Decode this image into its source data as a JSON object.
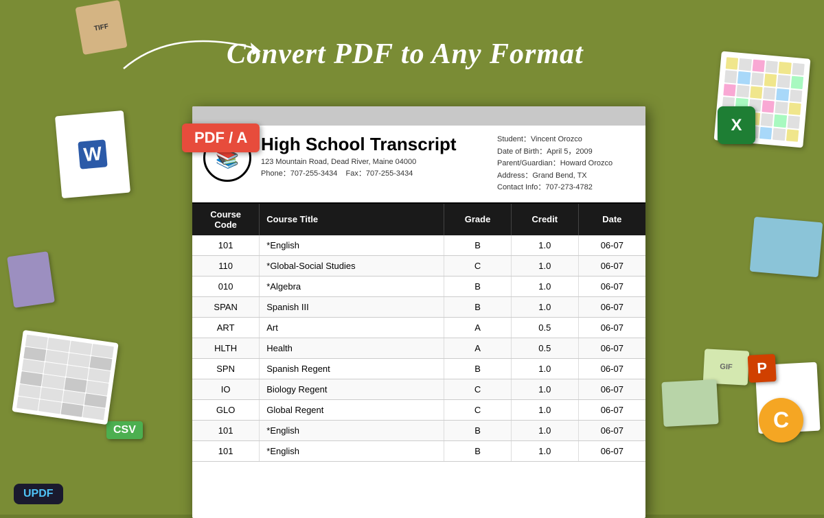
{
  "page": {
    "title": "Convert PDF to Any Format",
    "background_color": "#7a8c35"
  },
  "updf": {
    "label": "UPDF"
  },
  "pdf_badge": {
    "label": "PDF / A"
  },
  "document": {
    "logo_emoji": "📚",
    "title": "High School Transcript",
    "address": "123 Mountain Road, Dead River, Maine 04000",
    "phone": "Phone：707-255-3434",
    "fax": "Fax：707-255-3434",
    "student": "Student：Vincent Orozco",
    "dob": "Date of Birth：April 5，2009",
    "guardian": "Parent/Guardian：Howard Orozco",
    "address2": "Address：Grand Bend, TX",
    "contact": "Contact Info：707-273-4782",
    "table": {
      "headers": [
        "Course Code",
        "Course Title",
        "Grade",
        "Credit",
        "Date"
      ],
      "rows": [
        {
          "code": "101",
          "title": "*English",
          "grade": "B",
          "credit": "1.0",
          "date": "06-07"
        },
        {
          "code": "110",
          "title": "*Global-Social Studies",
          "grade": "C",
          "credit": "1.0",
          "date": "06-07"
        },
        {
          "code": "010",
          "title": "*Algebra",
          "grade": "B",
          "credit": "1.0",
          "date": "06-07"
        },
        {
          "code": "SPAN",
          "title": "Spanish III",
          "grade": "B",
          "credit": "1.0",
          "date": "06-07"
        },
        {
          "code": "ART",
          "title": "Art",
          "grade": "A",
          "credit": "0.5",
          "date": "06-07"
        },
        {
          "code": "HLTH",
          "title": "Health",
          "grade": "A",
          "credit": "0.5",
          "date": "06-07"
        },
        {
          "code": "SPN",
          "title": "Spanish Regent",
          "grade": "B",
          "credit": "1.0",
          "date": "06-07"
        },
        {
          "code": "IO",
          "title": "Biology Regent",
          "grade": "C",
          "credit": "1.0",
          "date": "06-07"
        },
        {
          "code": "GLO",
          "title": "Global Regent",
          "grade": "C",
          "credit": "1.0",
          "date": "06-07"
        },
        {
          "code": "101",
          "title": "*English",
          "grade": "B",
          "credit": "1.0",
          "date": "06-07"
        },
        {
          "code": "101",
          "title": "*English",
          "grade": "B",
          "credit": "1.0",
          "date": "06-07"
        }
      ]
    }
  },
  "decorations": {
    "tiff_label": "TIFF",
    "csv_label": "CSV",
    "gif_label": "GIF",
    "excel_label": "X",
    "ppt_label": "P",
    "c_label": "C"
  }
}
